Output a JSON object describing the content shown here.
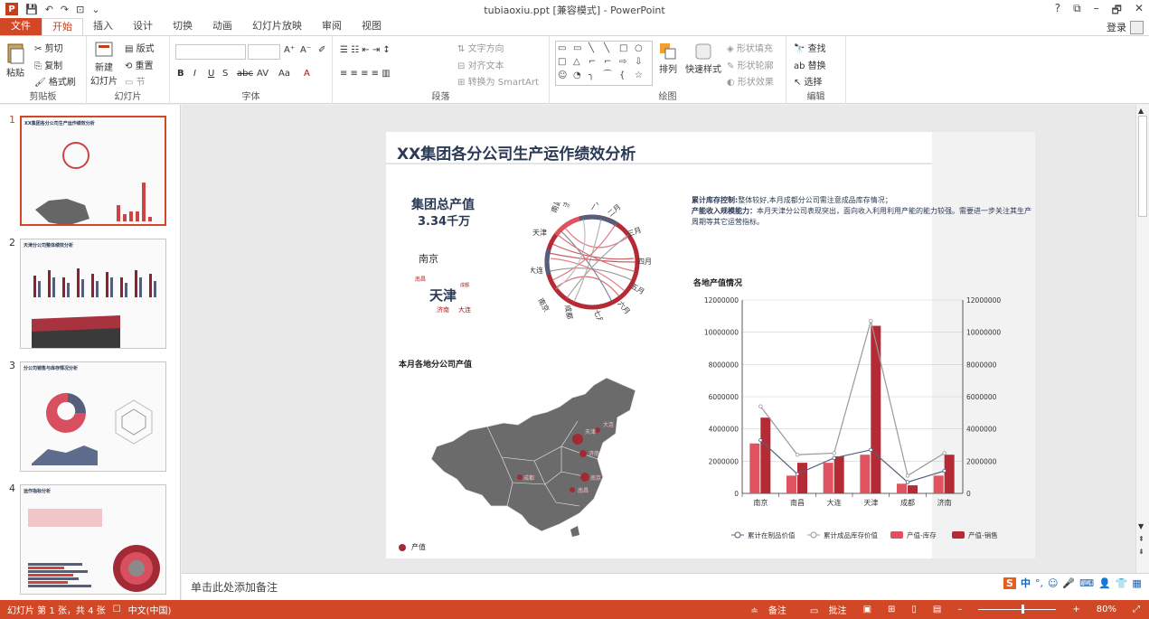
{
  "window": {
    "title": "tubiaoxiu.ppt [兼容模式] - PowerPoint",
    "help": "?",
    "restore": "⧉",
    "minimize": "–",
    "maximize": "🗗",
    "close": "✕",
    "qat": [
      "↶",
      "↷",
      "⊡",
      "⌄"
    ]
  },
  "tabs": [
    {
      "label": "文件"
    },
    {
      "label": "开始"
    },
    {
      "label": "插入"
    },
    {
      "label": "设计"
    },
    {
      "label": "切换"
    },
    {
      "label": "动画"
    },
    {
      "label": "幻灯片放映"
    },
    {
      "label": "审阅"
    },
    {
      "label": "视图"
    }
  ],
  "login": "登录",
  "ribbon": {
    "clipboard": {
      "label": "剪贴板",
      "paste": "粘贴",
      "cut": "剪切",
      "copy": "复制",
      "format": "格式刷"
    },
    "slides": {
      "label": "幻灯片",
      "new_slide": "新建",
      "new_slide2": "幻灯片",
      "layout": "版式",
      "reset": "重置",
      "section": "节"
    },
    "font": {
      "label": "字体",
      "bold": "B",
      "italic": "I",
      "underline": "U",
      "strike": "S",
      "abc": "abc",
      "spacing": "AV",
      "case": "Aa",
      "color": "A",
      "grow": "A⁺",
      "shrink": "A⁻",
      "clear": "✐"
    },
    "paragraph": {
      "label": "段落",
      "text_dir": "文字方向",
      "align_text": "对齐文本",
      "smartart": "转换为 SmartArt"
    },
    "drawing": {
      "label": "绘图",
      "arrange": "排列",
      "quick_styles": "快速样式",
      "fill": "形状填充",
      "outline": "形状轮廓",
      "effects": "形状效果"
    },
    "editing": {
      "label": "编辑",
      "find": "查找",
      "replace": "替换",
      "select": "选择"
    }
  },
  "slides": [
    {
      "num": "1",
      "title": "XX集团各分公司生产运作绩效分析"
    },
    {
      "num": "2",
      "title": "天津分公司整体绩效分析"
    },
    {
      "num": "3",
      "title": "分公司销售与库存情况分析"
    },
    {
      "num": "4",
      "title": "运作指标分析"
    }
  ],
  "slide": {
    "title": "XX集团各分公司生产运作绩效分析",
    "total_label": "集团总产值",
    "total_value": "3.34千万",
    "cities_cloud": [
      {
        "name": "南京"
      },
      {
        "name": "南昌"
      },
      {
        "name": "天津"
      },
      {
        "name": "成都"
      },
      {
        "name": "济南"
      },
      {
        "name": "大连"
      }
    ],
    "note_bold1": "累计库存控制:",
    "note_text1": "整体较好,本月成都分公司需注意成品库存情况；",
    "note_bold2": "产能收入规模能力：",
    "note_text2": "本月天津分公司表现突出，面向收入利用利用产能的能力较强。需要进一步关注其生产周期等其它运营指标。",
    "map_title": "本月各地分公司产值",
    "map_legend": "产值",
    "map_cities": [
      "南京",
      "天津",
      "济南",
      "大连",
      "南昌",
      "成都"
    ],
    "chord_labels": [
      "南昌",
      "济南",
      "天津",
      "大连",
      "南京",
      "一月",
      "二月",
      "三月",
      "四月",
      "五月",
      "六月",
      "七月",
      "成都"
    ],
    "chart_title": "各地产值情况"
  },
  "chart_data": {
    "type": "bar",
    "title": "各地产值情况",
    "categories": [
      "南京",
      "南昌",
      "大连",
      "天津",
      "成都",
      "济南"
    ],
    "ylim": [
      0,
      12000000
    ],
    "yticks": [
      "12000000",
      "10000000",
      "8000000",
      "6000000",
      "4000000",
      "2000000",
      "0"
    ],
    "series": [
      {
        "name": "累计在制品价值",
        "type": "line",
        "color": "#555e7b",
        "values": [
          3300000,
          1200000,
          2200000,
          2700000,
          700000,
          1400000
        ]
      },
      {
        "name": "累计成品库存价值",
        "type": "line",
        "color": "#999999",
        "values": [
          5400000,
          2400000,
          2500000,
          10700000,
          1100000,
          2500000
        ]
      },
      {
        "name": "产值-库存",
        "type": "bar",
        "color": "#e0525f",
        "values": [
          3100000,
          1100000,
          1900000,
          2400000,
          600000,
          1100000
        ]
      },
      {
        "name": "产值-销售",
        "type": "bar",
        "color": "#b52b35",
        "values": [
          4700000,
          1900000,
          2300000,
          10400000,
          500000,
          2400000
        ]
      }
    ]
  },
  "notes": "单击此处添加备注",
  "status": {
    "slide_info": "幻灯片 第 1 张，共 4 张",
    "lang": "中文(中国)",
    "notes": "备注",
    "comments": "批注",
    "zoom": "80%"
  },
  "ime": {
    "label": "中"
  }
}
